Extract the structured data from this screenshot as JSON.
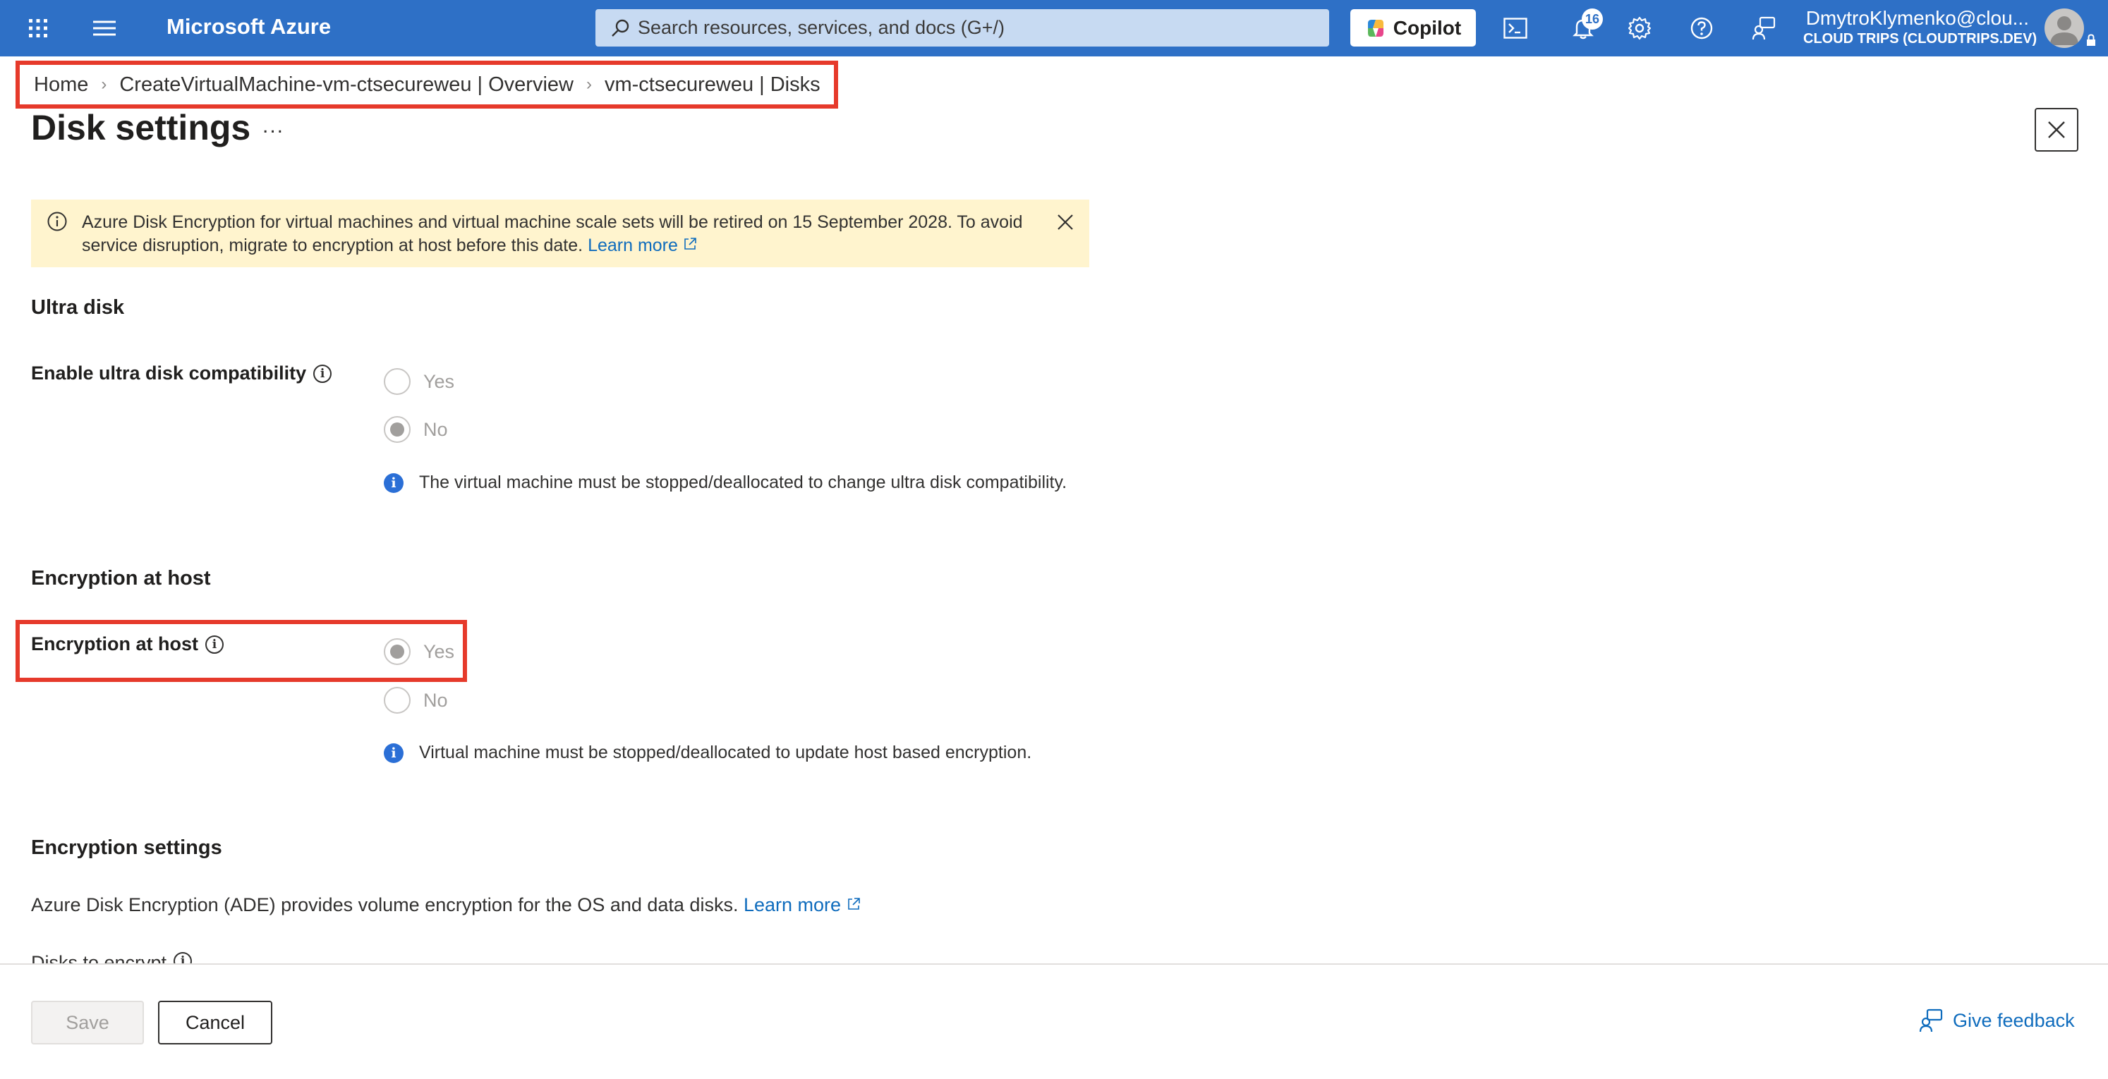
{
  "topbar": {
    "brand": "Microsoft Azure",
    "search_placeholder": "Search resources, services, and docs (G+/)",
    "copilot_label": "Copilot",
    "notification_count": "16",
    "account_name": "DmytroKlymenko@clou...",
    "account_org": "CLOUD TRIPS (CLOUDTRIPS.DEV)",
    "icons": [
      "portal-menu-icon",
      "hamburger-menu-icon",
      "search-icon",
      "copilot-icon",
      "cloud-shell-icon",
      "notifications-bell-icon",
      "settings-gear-icon",
      "help-question-icon",
      "feedback-person-icon",
      "lock-icon"
    ]
  },
  "breadcrumb": [
    "Home",
    "CreateVirtualMachine-vm-ctsecureweu | Overview",
    "vm-ctsecureweu | Disks"
  ],
  "page": {
    "title": "Disk settings",
    "more_label": "..."
  },
  "banner": {
    "message": "Azure Disk Encryption for virtual machines and virtual machine scale sets will be retired on 15 September 2028. To avoid service disruption, migrate to encryption at host before this date.",
    "link": "Learn more"
  },
  "ultra_disk": {
    "heading": "Ultra disk",
    "label": "Enable ultra disk compatibility",
    "options": [
      "Yes",
      "No"
    ],
    "selected": "No",
    "note": "The virtual machine must be stopped/deallocated to change ultra disk compatibility."
  },
  "encryption_at_host": {
    "heading": "Encryption at host",
    "label": "Encryption at host",
    "options": [
      "Yes",
      "No"
    ],
    "selected": "Yes",
    "note": "Virtual machine must be stopped/deallocated to update host based encryption."
  },
  "encryption_settings": {
    "heading": "Encryption settings",
    "description": "Azure Disk Encryption (ADE) provides volume encryption for the OS and data disks.",
    "link": "Learn more",
    "disks_label": "Disks to encrypt"
  },
  "footer": {
    "save": "Save",
    "cancel": "Cancel",
    "feedback": "Give feedback"
  },
  "colors": {
    "topbar": "#2e70c6",
    "highlight": "#e63a2b",
    "banner": "#fff4ce",
    "link": "#0f6cbd"
  }
}
